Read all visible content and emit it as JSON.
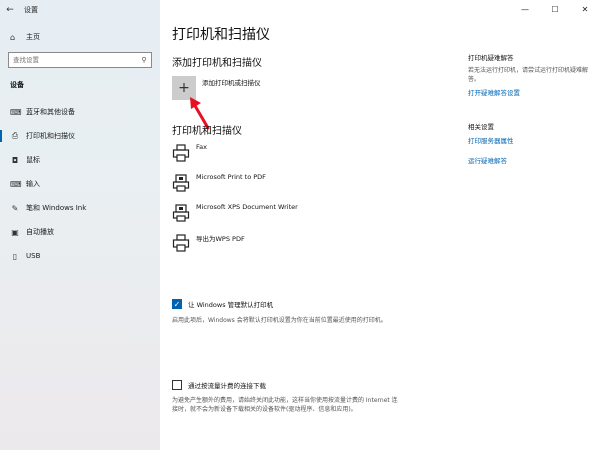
{
  "window": {
    "title": "设置",
    "back_glyph": "←",
    "controls": {
      "minimize": "—",
      "maximize": "☐",
      "close": "✕"
    }
  },
  "sidebar": {
    "home_label": "主页",
    "search": {
      "placeholder": "查找设置",
      "value": ""
    },
    "section_label": "设备",
    "items": [
      {
        "label": "蓝牙和其他设备",
        "icon": "bluetooth-devices-icon",
        "glyph": "⌨"
      },
      {
        "label": "打印机和扫描仪",
        "icon": "printer-icon",
        "glyph": "⎙",
        "active": true
      },
      {
        "label": "鼠标",
        "icon": "mouse-icon",
        "glyph": "◘"
      },
      {
        "label": "输入",
        "icon": "keyboard-icon",
        "glyph": "⌨"
      },
      {
        "label": "笔和 Windows Ink",
        "icon": "pen-icon",
        "glyph": "✎"
      },
      {
        "label": "自动播放",
        "icon": "autoplay-icon",
        "glyph": "▣"
      },
      {
        "label": "USB",
        "icon": "usb-icon",
        "glyph": "▯"
      }
    ]
  },
  "main": {
    "title": "打印机和扫描仪",
    "add_section_title": "添加打印机和扫描仪",
    "add_button_glyph": "+",
    "add_label": "添加打印机或扫描仪",
    "list_section_title": "打印机和扫描仪",
    "printers": [
      {
        "name": "Fax",
        "icon": "printer-icon"
      },
      {
        "name": "Microsoft Print to PDF",
        "icon": "pdf-printer-icon"
      },
      {
        "name": "Microsoft XPS Document Writer",
        "icon": "xps-printer-icon"
      },
      {
        "name": "导出为WPS PDF",
        "icon": "printer-icon"
      }
    ],
    "default_printer": {
      "checked": true,
      "label": "让 Windows 管理默认打印机",
      "description": "启用此项后，Windows 会将默认打印机设置为你在当前位置最近使用的打印机。"
    },
    "metered": {
      "checked": false,
      "label": "通过按流量计费的连接下载",
      "description": "为避免产生额外的费用，请始终关闭此功能，这样当你使用按流量计费的 Internet 连接时，就不会为新设备下载相关的设备软件(驱动程序、信息和应用)。"
    }
  },
  "right": {
    "troubleshoot_title": "打印机疑难解答",
    "troubleshoot_text": "若无法运行打印机，请尝试运行打印机疑难解答。",
    "troubleshoot_link": "打开疑难解答设置",
    "related_title": "相关设置",
    "server_props_link": "打印服务器属性",
    "run_troubleshooter_link": "运行疑难解答"
  },
  "colors": {
    "accent": "#0063b1",
    "arrow": "#e81123"
  }
}
